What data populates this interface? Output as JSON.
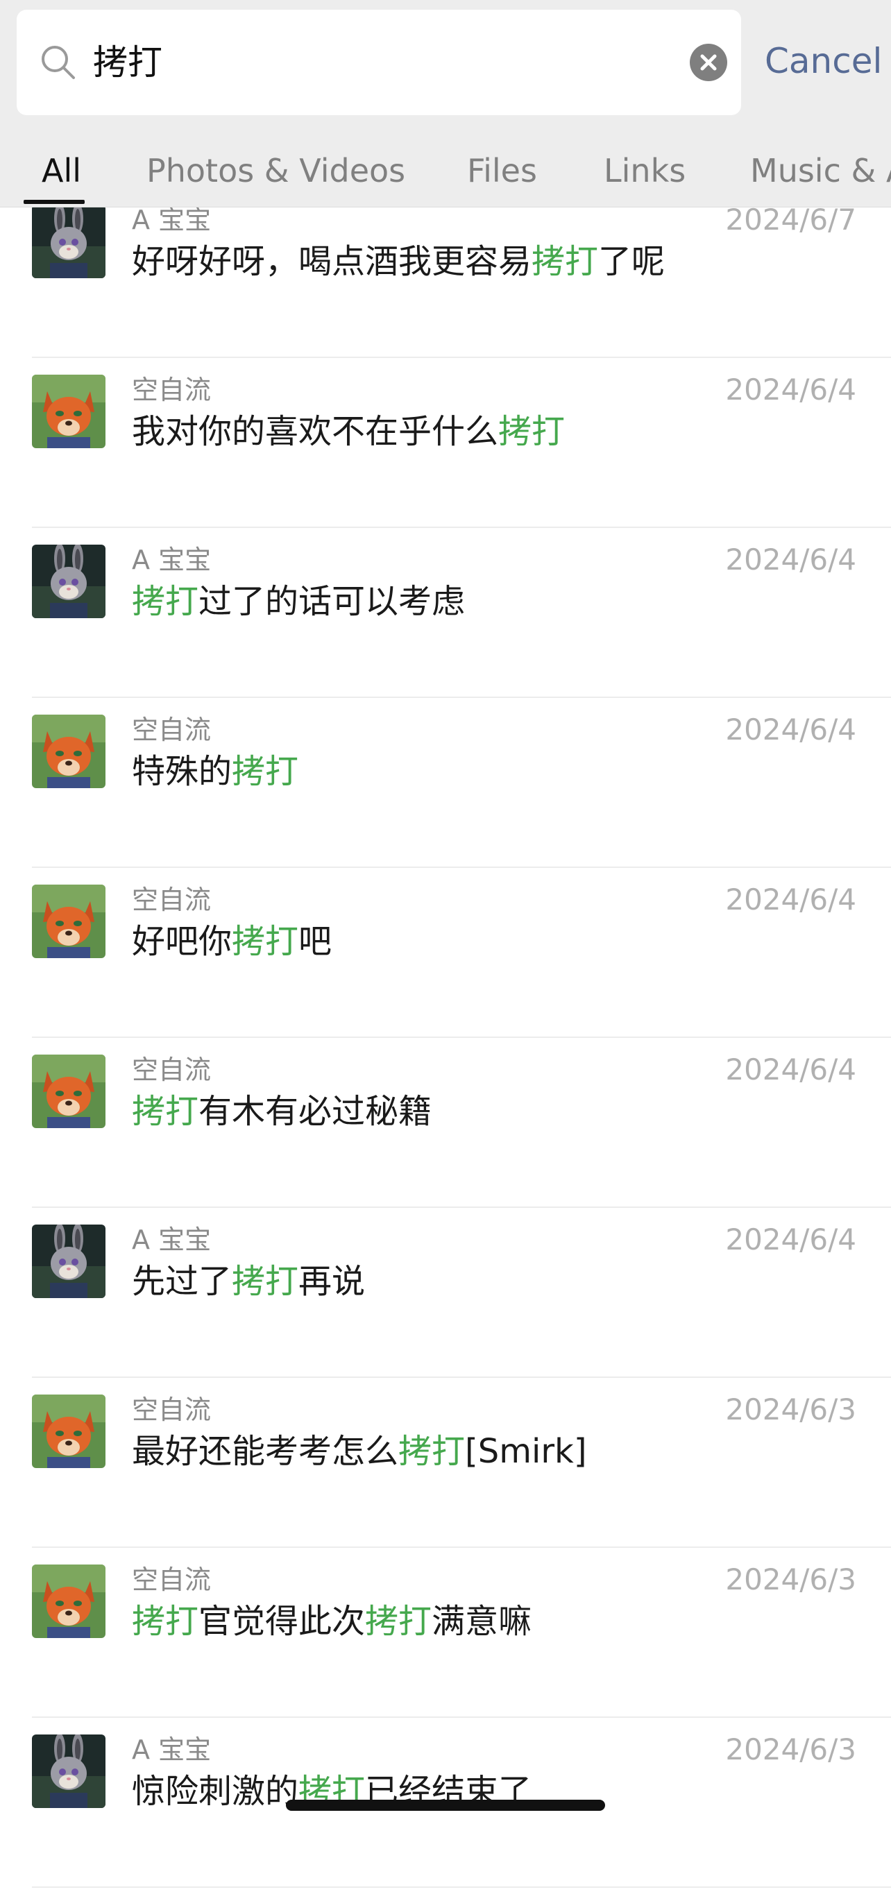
{
  "search": {
    "query": "拷打",
    "cancel_label": "Cancel"
  },
  "tabs": [
    {
      "label": "All",
      "active": true
    },
    {
      "label": "Photos & Videos",
      "active": false
    },
    {
      "label": "Files",
      "active": false
    },
    {
      "label": "Links",
      "active": false
    },
    {
      "label": "Music & A",
      "active": false
    }
  ],
  "colors": {
    "highlight": "#45a84d",
    "cancel_link": "#576b95",
    "header_bg": "#ededed"
  },
  "results": [
    {
      "sender": "A 宝宝",
      "avatar": "rabbit-avatar",
      "date": "2024/6/7",
      "segments": [
        {
          "t": "好呀好呀，喝点酒我更容易"
        },
        {
          "t": "拷打",
          "hl": true
        },
        {
          "t": "了呢"
        }
      ]
    },
    {
      "sender": "空自流",
      "avatar": "fox-avatar",
      "date": "2024/6/4",
      "segments": [
        {
          "t": "我对你的喜欢不在乎什么"
        },
        {
          "t": "拷打",
          "hl": true
        }
      ]
    },
    {
      "sender": "A 宝宝",
      "avatar": "rabbit-avatar",
      "date": "2024/6/4",
      "segments": [
        {
          "t": "拷打",
          "hl": true
        },
        {
          "t": "过了的话可以考虑"
        }
      ]
    },
    {
      "sender": "空自流",
      "avatar": "fox-avatar",
      "date": "2024/6/4",
      "segments": [
        {
          "t": "特殊的"
        },
        {
          "t": "拷打",
          "hl": true
        }
      ]
    },
    {
      "sender": "空自流",
      "avatar": "fox-avatar",
      "date": "2024/6/4",
      "segments": [
        {
          "t": "好吧你"
        },
        {
          "t": "拷打",
          "hl": true
        },
        {
          "t": "吧"
        }
      ]
    },
    {
      "sender": "空自流",
      "avatar": "fox-avatar",
      "date": "2024/6/4",
      "segments": [
        {
          "t": "拷打",
          "hl": true
        },
        {
          "t": "有木有必过秘籍"
        }
      ]
    },
    {
      "sender": "A 宝宝",
      "avatar": "rabbit-avatar",
      "date": "2024/6/4",
      "segments": [
        {
          "t": "先过了"
        },
        {
          "t": "拷打",
          "hl": true
        },
        {
          "t": "再说"
        }
      ]
    },
    {
      "sender": "空自流",
      "avatar": "fox-avatar",
      "date": "2024/6/3",
      "segments": [
        {
          "t": "最好还能考考怎么"
        },
        {
          "t": "拷打",
          "hl": true
        },
        {
          "t": "[Smirk]"
        }
      ]
    },
    {
      "sender": "空自流",
      "avatar": "fox-avatar",
      "date": "2024/6/3",
      "segments": [
        {
          "t": "拷打",
          "hl": true
        },
        {
          "t": "官觉得此次"
        },
        {
          "t": "拷打",
          "hl": true
        },
        {
          "t": "满意嘛"
        }
      ]
    },
    {
      "sender": "A 宝宝",
      "avatar": "rabbit-avatar",
      "date": "2024/6/3",
      "segments": [
        {
          "t": "惊险刺激的"
        },
        {
          "t": "拷打",
          "hl": true
        },
        {
          "t": "已经结束了"
        }
      ]
    }
  ]
}
